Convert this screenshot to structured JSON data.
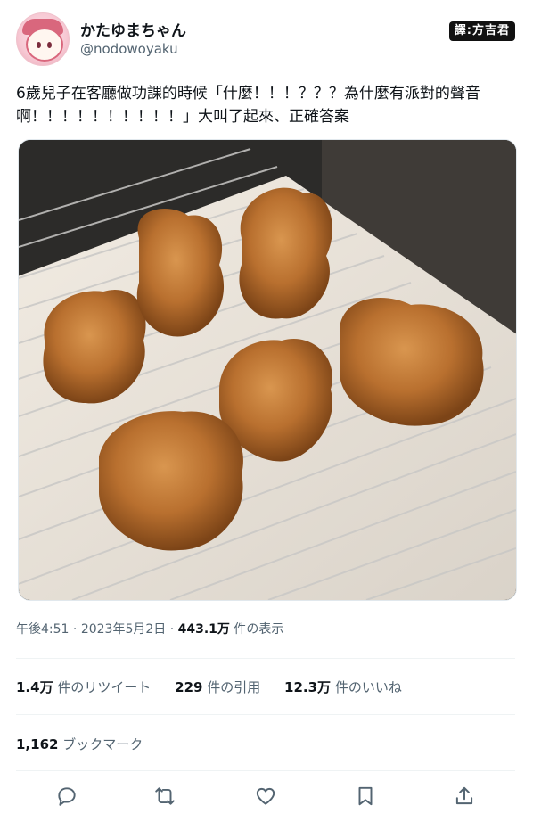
{
  "author": {
    "display_name": "かたゆまちゃん",
    "handle": "@nodowoyaku"
  },
  "translator_badge": "譯:方吉君",
  "tweet": {
    "text": "6歲兒子在客廳做功課的時候「什麼！！！？？？為什麼有派對的聲音啊！！！！！！！！！！」大叫了起來、正確答案"
  },
  "meta": {
    "time": "午後4:51",
    "sep": "·",
    "date": "2023年5月2日",
    "views_count": "443.1万",
    "views_label": "件の表示"
  },
  "stats": {
    "retweets_count": "1.4万",
    "retweets_label": "件のリツイート",
    "quotes_count": "229",
    "quotes_label": "件の引用",
    "likes_count": "12.3万",
    "likes_label": "件のいいね"
  },
  "bookmarks": {
    "count": "1,162",
    "label": "ブックマーク"
  },
  "actions": [
    "reply-icon",
    "retweet-icon",
    "like-icon",
    "bookmark-icon",
    "share-icon"
  ],
  "colors": {
    "text_primary": "#0f1419",
    "text_secondary": "#536471",
    "divider": "#eff3f4",
    "icon": "#536471"
  }
}
